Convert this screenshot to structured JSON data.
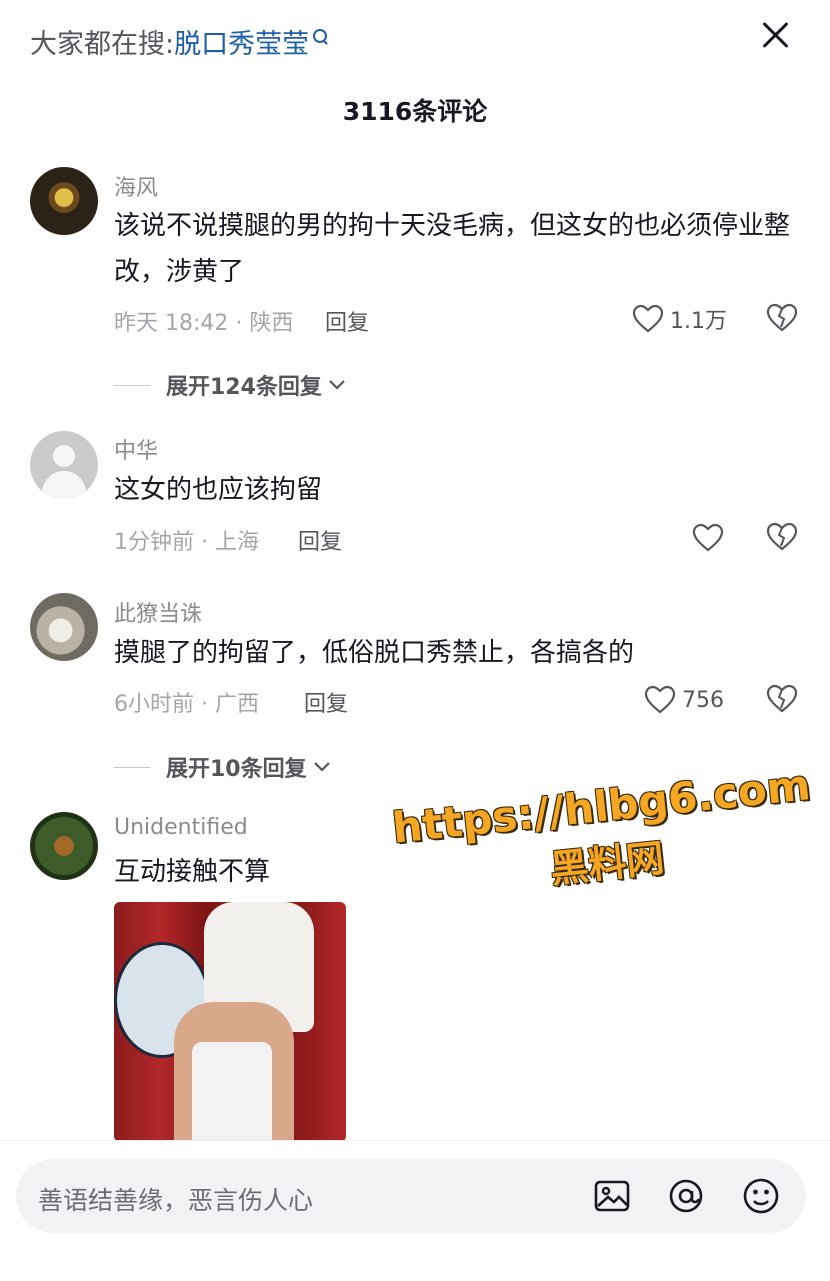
{
  "header": {
    "search_prefix": "大家都在搜:",
    "search_keyword": "脱口秀莹莹",
    "comment_count": "3116条评论"
  },
  "comments": [
    {
      "name": "海风",
      "text": "该说不说摸腿的男的拘十天没毛病，但这女的也必须停业整改，涉黄了",
      "meta": "昨天 18:42 · 陕西",
      "reply": "回复",
      "likes": "1.1万",
      "expand": "展开124条回复"
    },
    {
      "name": "中华",
      "text": "这女的也应该拘留",
      "meta": "1分钟前 · 上海",
      "reply": "回复",
      "likes": ""
    },
    {
      "name": "此獠当诛",
      "text": "摸腿了的拘留了，低俗脱口秀禁止，各搞各的",
      "meta": "6小时前 · 广西",
      "reply": "回复",
      "likes": "756",
      "expand": "展开10条回复"
    },
    {
      "name": "Unidentified",
      "text": "互动接触不算"
    }
  ],
  "watermark": {
    "line1": "https://hlbg6.com",
    "line2": "黑料网"
  },
  "input": {
    "placeholder": "善语结善缘，恶言伤人心"
  },
  "icons": {
    "close": "close-icon",
    "like": "heart-icon",
    "dislike": "broken-heart-icon",
    "image": "image-icon",
    "mention": "at-icon",
    "emoji": "emoji-icon"
  }
}
